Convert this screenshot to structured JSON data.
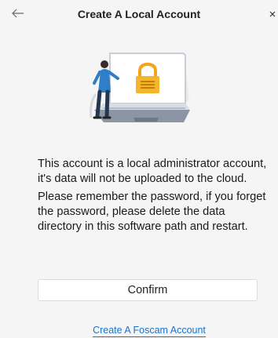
{
  "window": {
    "title": "Create A Local Account",
    "back_icon": "arrow-left-icon",
    "close_icon": "close-icon"
  },
  "illustration": {
    "icon": "laptop-lock-illustration",
    "accent_color": "#f2a51a"
  },
  "message": {
    "paragraph1": "This account is a local administrator account, it's data will not be uploaded to the cloud.",
    "paragraph2": "Please remember the password, if you forget the password, please delete the data directory in this software path and restart."
  },
  "actions": {
    "confirm_label": "Confirm",
    "create_foscam_label": "Create A Foscam Account"
  },
  "colors": {
    "background": "#f5f5f5",
    "link": "#1a73c9"
  }
}
